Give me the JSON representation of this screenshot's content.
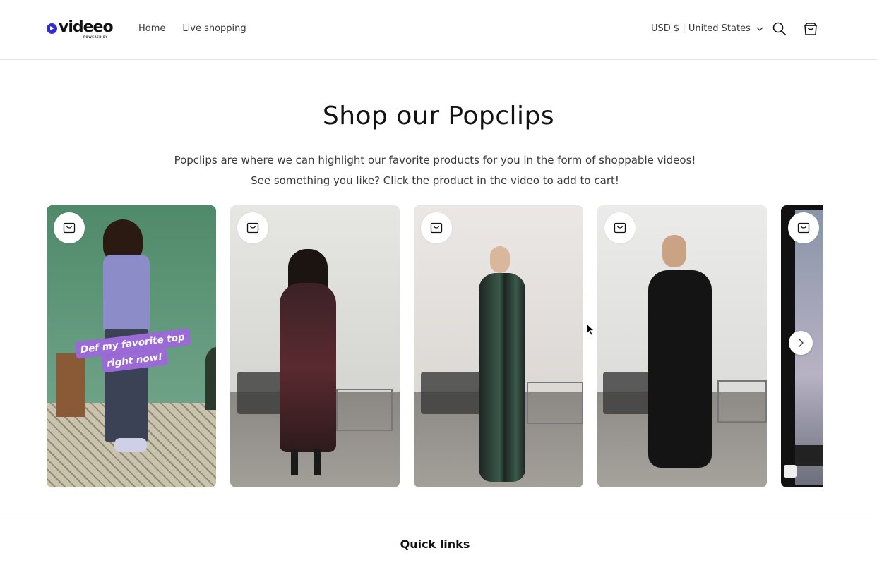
{
  "header": {
    "logo_text": "videeo",
    "logo_subtext": "POWERED BY",
    "nav": [
      "Home",
      "Live shopping"
    ],
    "currency_label": "USD $ | United States",
    "icons": [
      "search-icon",
      "cart-icon",
      "chevron-down-icon"
    ]
  },
  "main": {
    "title": "Shop our Popclips",
    "description": "Popclips are where we can highlight our favorite products for you in the form of shoppable videos! See something you like? Click the product in the video to add to cart!",
    "cards": [
      {
        "caption_line1": "Def my favorite top",
        "caption_line2": "right now!"
      },
      {},
      {},
      {},
      {}
    ]
  },
  "footer": {
    "title": "Quick links"
  },
  "colors": {
    "accent": "#2f2bd6",
    "caption_bg": "#9a6ad6"
  }
}
